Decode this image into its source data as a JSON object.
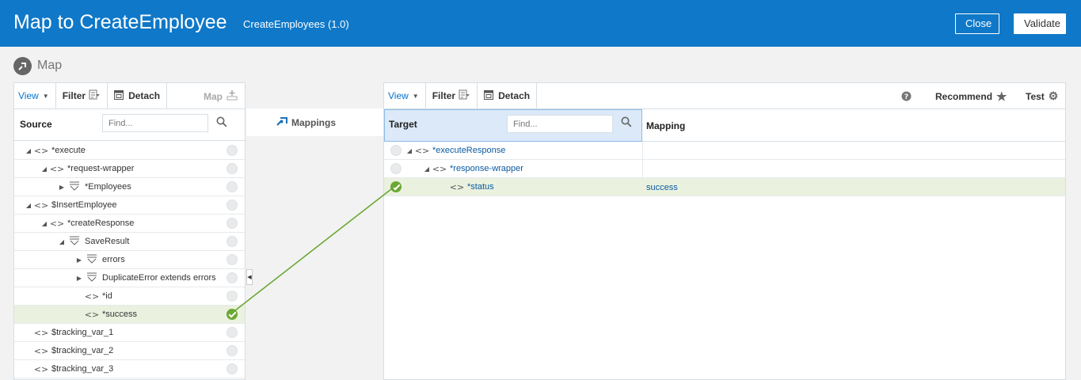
{
  "header": {
    "title": "Map to CreateEmployee",
    "subtitle": "CreateEmployees (1.0)",
    "close_label": "Close",
    "validate_label": "Validate"
  },
  "map_label": "Map",
  "source": {
    "toolbar": {
      "view": "View",
      "filter": "Filter",
      "detach": "Detach",
      "map": "Map"
    },
    "header_label": "Source",
    "find_placeholder": "Find...",
    "rows": [
      {
        "label": "*execute"
      },
      {
        "label": "*request-wrapper"
      },
      {
        "label": "*Employees"
      },
      {
        "label": "$InsertEmployee"
      },
      {
        "label": "*createResponse"
      },
      {
        "label": "SaveResult"
      },
      {
        "label": "errors"
      },
      {
        "label": "DuplicateError extends errors"
      },
      {
        "label": "*id"
      },
      {
        "label": "*success"
      },
      {
        "label": "$tracking_var_1"
      },
      {
        "label": "$tracking_var_2"
      },
      {
        "label": "$tracking_var_3"
      }
    ]
  },
  "middle": {
    "mappings_label": "Mappings"
  },
  "target": {
    "toolbar": {
      "view": "View",
      "filter": "Filter",
      "detach": "Detach",
      "recommend": "Recommend",
      "test": "Test"
    },
    "header_label": "Target",
    "find_placeholder": "Find...",
    "mapping_header": "Mapping",
    "rows": [
      {
        "label": "*executeResponse",
        "mapping": ""
      },
      {
        "label": "*response-wrapper",
        "mapping": ""
      },
      {
        "label": "*status",
        "mapping": "success"
      }
    ]
  },
  "colors": {
    "header_bg": "#0f78c8",
    "mapped": "#6ba834",
    "link": "#0572ce"
  }
}
